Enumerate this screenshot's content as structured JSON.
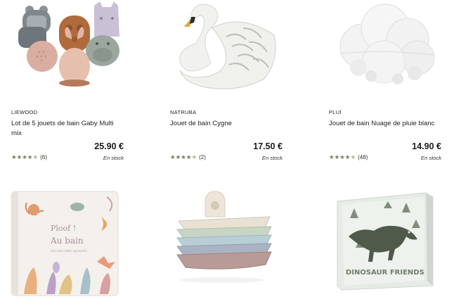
{
  "products": [
    {
      "brand": "LIEWOOD",
      "title": "Lot de 5 jouets de bain Gaby Multi mix",
      "price": "25.90 €",
      "reviews": "(6)",
      "rating": 4.5,
      "stock": "En stock",
      "image_icon": "bath-toys-set-image"
    },
    {
      "brand": "NATRUBA",
      "title": "Jouet de bain Cygne",
      "price": "17.50 €",
      "reviews": "(2)",
      "rating": 4.5,
      "stock": "En stock",
      "image_icon": "swan-toy-image"
    },
    {
      "brand": "PLUÏ",
      "title": "Jouet de bain Nuage de pluie blanc",
      "price": "14.90 €",
      "reviews": "(48)",
      "rating": 4.5,
      "stock": "En stock",
      "image_icon": "cloud-toy-image"
    }
  ],
  "bottom_row": [
    {
      "image_icon": "bath-book-image",
      "book_title": "Ploof !",
      "book_subtitle": "Au bain",
      "book_note": "mon bain bébé apprendre"
    },
    {
      "image_icon": "stacking-boats-image"
    },
    {
      "image_icon": "dinosaur-book-image",
      "book_title": "DINOSAUR FRIENDS"
    }
  ],
  "colors": {
    "star": "#7d7a5e",
    "text": "#222222",
    "background": "#ffffff"
  }
}
